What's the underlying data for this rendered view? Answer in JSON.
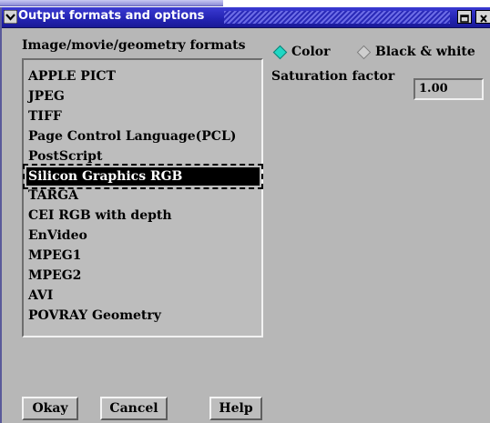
{
  "window": {
    "title": "Output formats and options"
  },
  "formats": {
    "header": "Image/movie/geometry formats",
    "items": [
      "APPLE PICT",
      "JPEG",
      "TIFF",
      "Page Control Language(PCL)",
      "PostScript",
      "Silicon Graphics RGB",
      "TARGA",
      "CEI RGB with depth",
      "EnVideo",
      "MPEG1",
      "MPEG2",
      "AVI",
      "POVRAY Geometry"
    ],
    "selected": "Silicon Graphics RGB"
  },
  "color_mode": {
    "options": [
      "Color",
      "Black & white"
    ],
    "selected": "Color"
  },
  "saturation": {
    "label": "Saturation factor",
    "value": "1.00"
  },
  "buttons": {
    "okay": "Okay",
    "cancel": "Cancel",
    "help": "Help"
  },
  "colors": {
    "titlebar": "#2424b4",
    "window_bg": "#b7b7b7",
    "radio_on": "#1fd7c4"
  }
}
